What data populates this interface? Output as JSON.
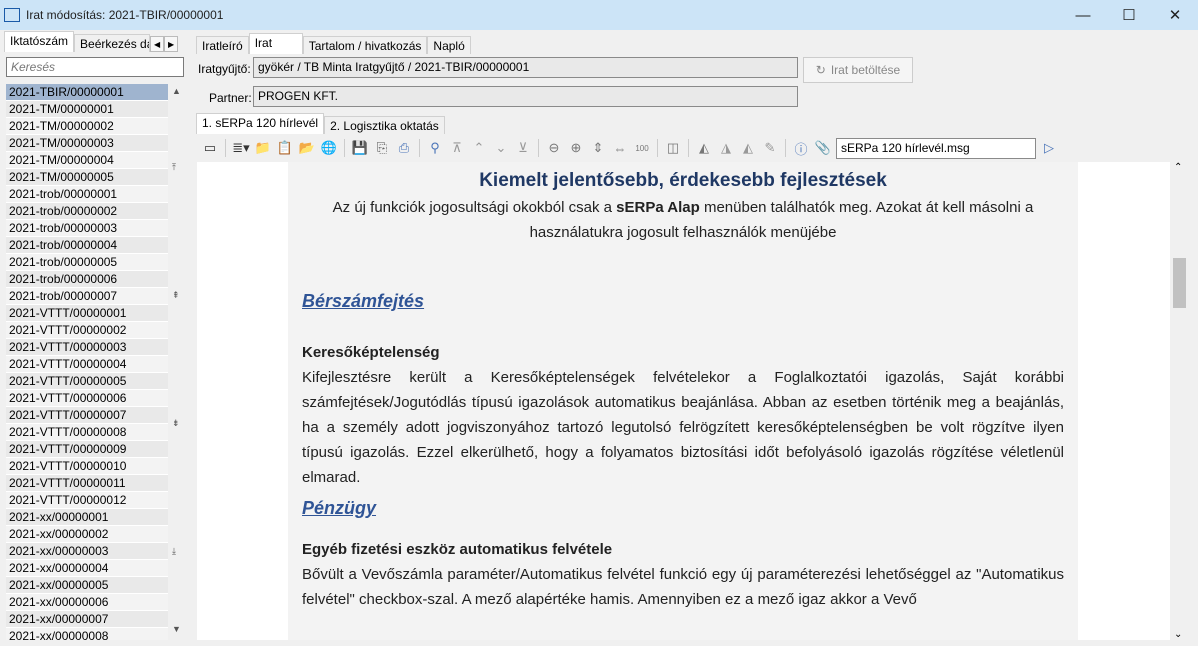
{
  "window": {
    "title": "Irat módosítás: 2021-TBIR/00000001",
    "minimize": "—",
    "maximize": "☐",
    "close": "✕"
  },
  "left": {
    "tabs": [
      "Iktatószám",
      "Beérkezés dát"
    ],
    "search_placeholder": "Keresés",
    "items": [
      "2021-TBIR/00000001",
      "2021-TM/00000001",
      "2021-TM/00000002",
      "2021-TM/00000003",
      "2021-TM/00000004",
      "2021-TM/00000005",
      "2021-trob/00000001",
      "2021-trob/00000002",
      "2021-trob/00000003",
      "2021-trob/00000004",
      "2021-trob/00000005",
      "2021-trob/00000006",
      "2021-trob/00000007",
      "2021-VTTT/00000001",
      "2021-VTTT/00000002",
      "2021-VTTT/00000003",
      "2021-VTTT/00000004",
      "2021-VTTT/00000005",
      "2021-VTTT/00000006",
      "2021-VTTT/00000007",
      "2021-VTTT/00000008",
      "2021-VTTT/00000009",
      "2021-VTTT/00000010",
      "2021-VTTT/00000011",
      "2021-VTTT/00000012",
      "2021-xx/00000001",
      "2021-xx/00000002",
      "2021-xx/00000003",
      "2021-xx/00000004",
      "2021-xx/00000005",
      "2021-xx/00000006",
      "2021-xx/00000007",
      "2021-xx/00000008"
    ]
  },
  "main": {
    "tabs": [
      "Iratleíró",
      "Irat",
      "Tartalom / hivatkozás",
      "Napló"
    ],
    "iratgyujto_label": "Iratgyűjtő:",
    "iratgyujto_value": "gyökér / TB Minta Iratgyűjtő / 2021-TBIR/00000001",
    "partner_label": "Partner:",
    "partner_value": "PROGEN KFT.",
    "load_button": "Irat betöltése",
    "doc_tabs": [
      "1. sERPa 120 hírlevél",
      "2. Logisztika oktatás"
    ],
    "filename": "sERPa 120 hírlevél.msg"
  },
  "document": {
    "title": "Kiemelt jelentősebb, érdekesebb fejlesztések",
    "intro_pre": "Az új funkciók jogosultsági okokból csak a ",
    "intro_bold": "sERPa Alap",
    "intro_post": " menüben találhatók meg. Azokat át kell másolni a használatukra jogosult felhasználók menüjébe",
    "s1_title": "Bérszámfejtés",
    "s1_sub": "Keresőképtelenség",
    "s1_text": "Kifejlesztésre került a Keresőképtelenségek felvételekor a Foglalkoztatói igazolás, Saját korábbi számfejtések/Jogutódlás típusú igazolások automatikus beajánlása. Abban az esetben történik meg a beajánlás, ha a személy adott jogviszonyához tartozó legutolsó felrögzített keresőképtelenségben be volt rögzítve ilyen típusú igazolás. Ezzel elkerülhető, hogy a folyamatos biztosítási időt befolyásoló igazolás rögzítése véletlenül elmarad.",
    "s2_title": "Pénzügy",
    "s2_sub": "Egyéb fizetési eszköz automatikus felvétele",
    "s2_text": "Bővült a Vevőszámla paraméter/Automatikus felvétel funkció egy új paraméterezési lehetőséggel az \"Automatikus felvétel\" checkbox-szal. A mező alapértéke hamis. Amennyiben ez a mező igaz akkor a Vevő"
  }
}
